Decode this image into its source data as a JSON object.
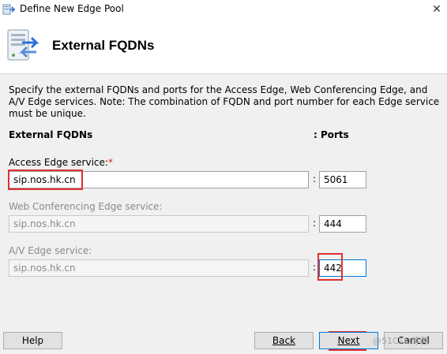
{
  "window": {
    "title": "Define New Edge Pool"
  },
  "header": {
    "title": "External FQDNs"
  },
  "description": "Specify the external FQDNs and ports for the Access Edge, Web Conferencing Edge, and A/V Edge services. Note: The combination of FQDN and port number for each Edge service must be unique.",
  "columns": {
    "fqdns": "External FQDNs",
    "ports": ": Ports"
  },
  "fields": [
    {
      "label": "Access Edge service:",
      "required_mark": "*",
      "fqdn": "sip.nos.hk.cn",
      "port": "5061",
      "enabled": true
    },
    {
      "label": "Web Conferencing Edge service:",
      "fqdn": "sip.nos.hk.cn",
      "port": "444",
      "enabled": false
    },
    {
      "label": "A/V Edge service:",
      "fqdn": "sip.nos.hk.cn",
      "port": "442",
      "enabled": false
    }
  ],
  "separator": ":",
  "buttons": {
    "help": "Help",
    "back": "Back",
    "next": "Next",
    "cancel": "Cancel"
  },
  "watermark": "@51CTO博客",
  "colors": {
    "highlight": "#e03030",
    "focus": "#0078d7"
  }
}
